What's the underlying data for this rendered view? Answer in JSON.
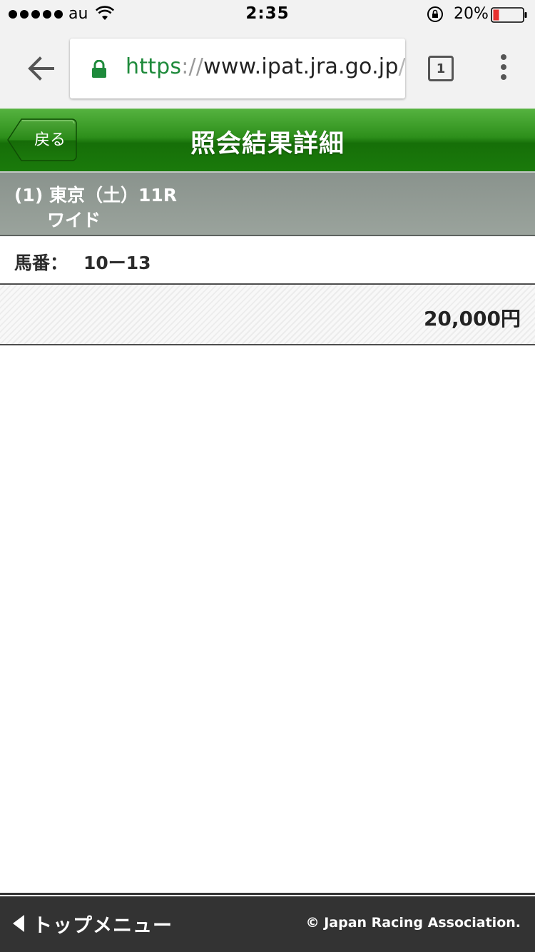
{
  "status_bar": {
    "carrier": "au",
    "time": "2:35",
    "battery": "20%"
  },
  "browser": {
    "url_scheme": "https",
    "url_sep": "://",
    "url_host": "www.ipat.jra.go.jp",
    "url_rest": "/s",
    "tab_count": "1"
  },
  "header": {
    "back_label": "戻る",
    "title": "照会結果詳細"
  },
  "race": {
    "line1": "(1) 東京（土）11R",
    "bet_type": "ワイド"
  },
  "horse": {
    "label": "馬番：",
    "value": "10ー13"
  },
  "amount": {
    "value": "20,000円"
  },
  "footer": {
    "top_menu_label": "トップメニュー",
    "copyright": "© Japan Racing Association."
  },
  "colors": {
    "header_green": "#1a7a0b",
    "race_band_gray": "#9aa39c",
    "footer_dark": "#333333",
    "battery_low": "#e8312f",
    "secure_green": "#1e8a3b"
  }
}
